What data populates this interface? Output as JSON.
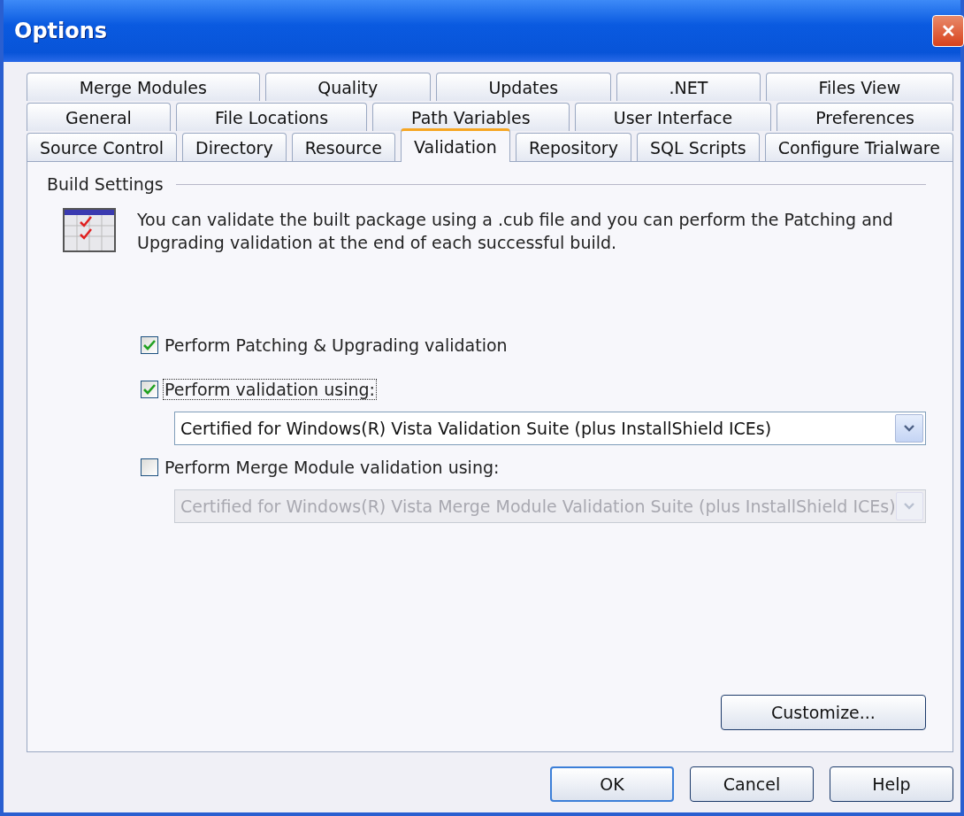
{
  "window": {
    "title": "Options",
    "close": "✕"
  },
  "tab_rows": [
    [
      {
        "label": "Merge Modules",
        "selected": false
      },
      {
        "label": "Quality",
        "selected": false
      },
      {
        "label": "Updates",
        "selected": false
      },
      {
        "label": ".NET",
        "selected": false
      },
      {
        "label": "Files View",
        "selected": false
      }
    ],
    [
      {
        "label": "General",
        "selected": false
      },
      {
        "label": "File Locations",
        "selected": false
      },
      {
        "label": "Path Variables",
        "selected": false
      },
      {
        "label": "User Interface",
        "selected": false
      },
      {
        "label": "Preferences",
        "selected": false
      }
    ],
    [
      {
        "label": "Source Control",
        "selected": false
      },
      {
        "label": "Directory",
        "selected": false
      },
      {
        "label": "Resource",
        "selected": false
      },
      {
        "label": "Validation",
        "selected": true
      },
      {
        "label": "Repository",
        "selected": false
      },
      {
        "label": "SQL Scripts",
        "selected": false
      },
      {
        "label": "Configure Trialware",
        "selected": false
      }
    ]
  ],
  "group": {
    "title": "Build Settings",
    "description": "You can validate the built package using a .cub file and you can perform the Patching and Upgrading validation at the end of each successful build."
  },
  "options": [
    {
      "kind": "checkbox",
      "label": "Perform Patching & Upgrading validation",
      "checked": true,
      "focused": false
    },
    {
      "kind": "checkbox",
      "label": "Perform validation using:",
      "checked": true,
      "focused": true
    },
    {
      "kind": "dropdown",
      "value": "Certified for Windows(R) Vista Validation Suite (plus InstallShield ICEs)",
      "disabled": false
    },
    {
      "kind": "checkbox",
      "label": "Perform Merge Module validation using:",
      "checked": false,
      "focused": false
    },
    {
      "kind": "dropdown",
      "value": "Certified for Windows(R) Vista Merge Module Validation Suite (plus InstallShield ICEs)",
      "disabled": true
    }
  ],
  "customize_button": "Customize...",
  "buttons": [
    {
      "label": "OK",
      "default": true
    },
    {
      "label": "Cancel",
      "default": false
    },
    {
      "label": "Help",
      "default": false
    }
  ]
}
